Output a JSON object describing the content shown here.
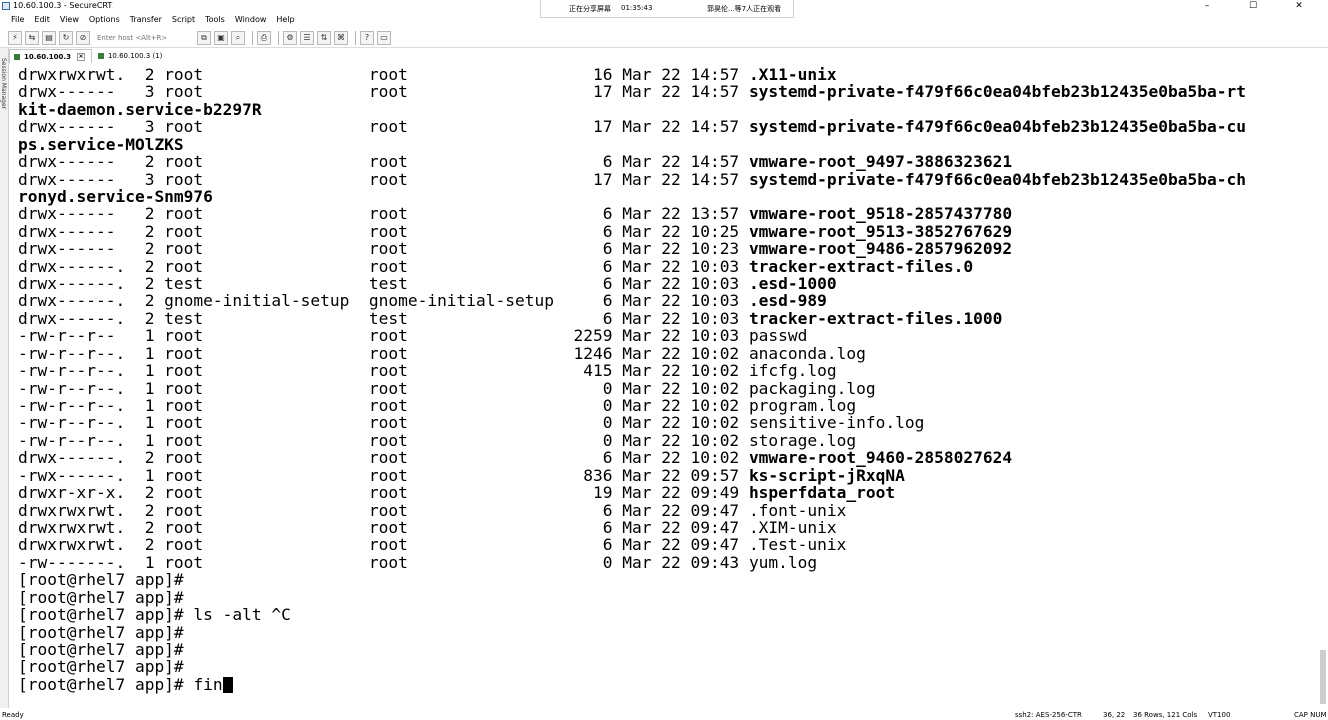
{
  "window": {
    "title": "10.60.100.3 - SecureCRT",
    "minimize": "–",
    "maximize": "☐",
    "close": "✕"
  },
  "overlay": {
    "sharing": "正在分享屏幕",
    "timer": "01:35:43",
    "viewers": "郭昊伦...等7人正在观看"
  },
  "menu": [
    "File",
    "Edit",
    "View",
    "Options",
    "Transfer",
    "Script",
    "Tools",
    "Window",
    "Help"
  ],
  "toolbar": {
    "host_placeholder": "Enter host <Alt+R>"
  },
  "sidebar": {
    "label": "Session Manager"
  },
  "tabs": [
    {
      "label": "10.60.100.3",
      "active": true
    },
    {
      "label": "10.60.100.3 (1)",
      "active": false
    }
  ],
  "terminal": {
    "lines": [
      {
        "text": "drwxrwxrwt.  2 root                 root                   16 Mar 22 14:57 ",
        "name": ".X11-unix",
        "bold": true
      },
      {
        "text": "drwx------   3 root                 root                   17 Mar 22 14:57 ",
        "name": "systemd-private-f479f66c0ea04bfeb23b12435e0ba5ba-rt",
        "bold": true
      },
      {
        "text": "",
        "name": "kit-daemon.service-b2297R",
        "bold": true
      },
      {
        "text": "drwx------   3 root                 root                   17 Mar 22 14:57 ",
        "name": "systemd-private-f479f66c0ea04bfeb23b12435e0ba5ba-cu",
        "bold": true
      },
      {
        "text": "",
        "name": "ps.service-MOlZKS",
        "bold": true
      },
      {
        "text": "drwx------   2 root                 root                    6 Mar 22 14:57 ",
        "name": "vmware-root_9497-3886323621",
        "bold": true
      },
      {
        "text": "drwx------   3 root                 root                   17 Mar 22 14:57 ",
        "name": "systemd-private-f479f66c0ea04bfeb23b12435e0ba5ba-ch",
        "bold": true
      },
      {
        "text": "",
        "name": "ronyd.service-Snm976",
        "bold": true
      },
      {
        "text": "drwx------   2 root                 root                    6 Mar 22 13:57 ",
        "name": "vmware-root_9518-2857437780",
        "bold": true
      },
      {
        "text": "drwx------   2 root                 root                    6 Mar 22 10:25 ",
        "name": "vmware-root_9513-3852767629",
        "bold": true
      },
      {
        "text": "drwx------   2 root                 root                    6 Mar 22 10:23 ",
        "name": "vmware-root_9486-2857962092",
        "bold": true
      },
      {
        "text": "drwx------.  2 root                 root                    6 Mar 22 10:03 ",
        "name": "tracker-extract-files.0",
        "bold": true
      },
      {
        "text": "drwx------.  2 test                 test                    6 Mar 22 10:03 ",
        "name": ".esd-1000",
        "bold": true
      },
      {
        "text": "drwx------.  2 gnome-initial-setup  gnome-initial-setup     6 Mar 22 10:03 ",
        "name": ".esd-989",
        "bold": true
      },
      {
        "text": "drwx------.  2 test                 test                    6 Mar 22 10:03 ",
        "name": "tracker-extract-files.1000",
        "bold": true
      },
      {
        "text": "-rw-r--r--   1 root                 root                 2259 Mar 22 10:03 ",
        "name": "passwd",
        "bold": false
      },
      {
        "text": "-rw-r--r--.  1 root                 root                 1246 Mar 22 10:02 ",
        "name": "anaconda.log",
        "bold": false
      },
      {
        "text": "-rw-r--r--.  1 root                 root                  415 Mar 22 10:02 ",
        "name": "ifcfg.log",
        "bold": false
      },
      {
        "text": "-rw-r--r--.  1 root                 root                    0 Mar 22 10:02 ",
        "name": "packaging.log",
        "bold": false
      },
      {
        "text": "-rw-r--r--.  1 root                 root                    0 Mar 22 10:02 ",
        "name": "program.log",
        "bold": false
      },
      {
        "text": "-rw-r--r--.  1 root                 root                    0 Mar 22 10:02 ",
        "name": "sensitive-info.log",
        "bold": false
      },
      {
        "text": "-rw-r--r--.  1 root                 root                    0 Mar 22 10:02 ",
        "name": "storage.log",
        "bold": false
      },
      {
        "text": "drwx------.  2 root                 root                    6 Mar 22 10:02 ",
        "name": "vmware-root_9460-2858027624",
        "bold": true
      },
      {
        "text": "-rwx------.  1 root                 root                  836 Mar 22 09:57 ",
        "name": "ks-script-jRxqNA",
        "bold": true
      },
      {
        "text": "drwxr-xr-x.  2 root                 root                   19 Mar 22 09:49 ",
        "name": "hsperfdata_root",
        "bold": true
      },
      {
        "text": "drwxrwxrwt.  2 root                 root                    6 Mar 22 09:47 ",
        "name": ".font-unix",
        "bold": false
      },
      {
        "text": "drwxrwxrwt.  2 root                 root                    6 Mar 22 09:47 ",
        "name": ".XIM-unix",
        "bold": false
      },
      {
        "text": "drwxrwxrwt.  2 root                 root                    6 Mar 22 09:47 ",
        "name": ".Test-unix",
        "bold": false
      },
      {
        "text": "-rw-------.  1 root                 root                    0 Mar 22 09:43 ",
        "name": "yum.log",
        "bold": false
      },
      {
        "text": "[root@rhel7 app]#",
        "name": "",
        "bold": false
      },
      {
        "text": "[root@rhel7 app]#",
        "name": "",
        "bold": false
      },
      {
        "text": "[root@rhel7 app]# ls -alt ^C",
        "name": "",
        "bold": false
      },
      {
        "text": "[root@rhel7 app]#",
        "name": "",
        "bold": false
      },
      {
        "text": "[root@rhel7 app]#",
        "name": "",
        "bold": false
      },
      {
        "text": "[root@rhel7 app]#",
        "name": "",
        "bold": false
      }
    ],
    "current_prompt": "[root@rhel7 app]# ",
    "current_input": "fin"
  },
  "status": {
    "ready": "Ready",
    "cipher": "ssh2: AES-256-CTR",
    "position": "36, 22",
    "size": "36 Rows, 121 Cols",
    "emulation": "VT100",
    "keys": "CAP NUM"
  }
}
